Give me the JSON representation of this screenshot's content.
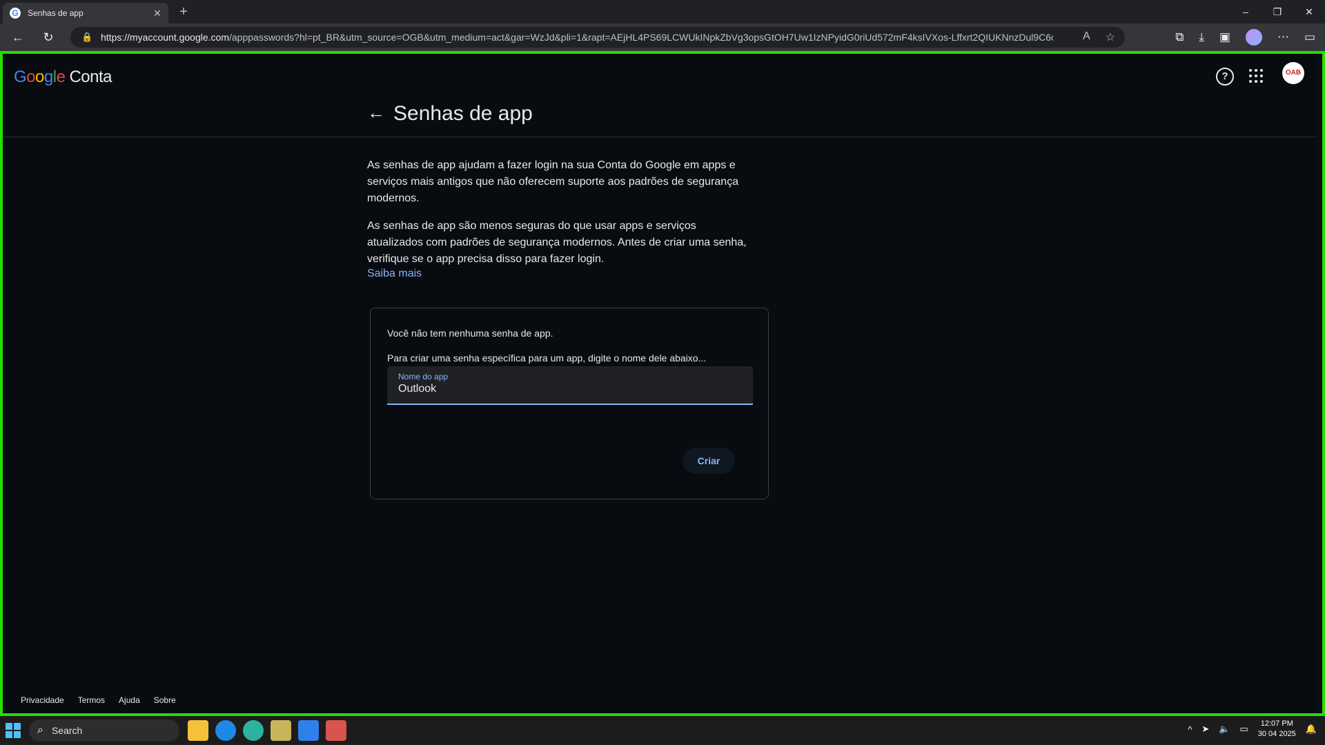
{
  "browser": {
    "tab_title": "Senhas de app",
    "url_host": "https://myaccount.google.com",
    "url_path": "/apppasswords?hl=pt_BR&utm_source=OGB&utm_medium=act&gar=WzJd&pli=1&rapt=AEjHL4PS69LCWUkINpkZbVg3opsGtOH7Uw1IzNPyidG0riUd572mF4ksIVXos-Lffxrt2QIUKNnzDul9C6cF..."
  },
  "header": {
    "logo_letters": [
      "G",
      "o",
      "o",
      "g",
      "l",
      "e"
    ],
    "logo_suffix": "Conta",
    "avatar_text": "OAB"
  },
  "page": {
    "title": "Senhas de app",
    "para1": "As senhas de app ajudam a fazer login na sua Conta do Google em apps e serviços mais antigos que não oferecem suporte aos padrões de segurança modernos.",
    "para2": "As senhas de app são menos seguras do que usar apps e serviços atualizados com padrões de segurança modernos. Antes de criar uma senha, verifique se o app precisa disso para fazer login.",
    "learn_more": "Saiba mais"
  },
  "card": {
    "no_passwords": "Você não tem nenhuma senha de app.",
    "instruction": "Para criar uma senha específica para um app, digite o nome dele abaixo...",
    "field_label": "Nome do app",
    "field_value": "Outlook",
    "create_button": "Criar"
  },
  "footer": {
    "links": [
      "Privacidade",
      "Termos",
      "Ajuda",
      "Sobre"
    ]
  },
  "taskbar": {
    "search_placeholder": "Search",
    "time": "12:07 PM",
    "date": "30 04 2025"
  }
}
